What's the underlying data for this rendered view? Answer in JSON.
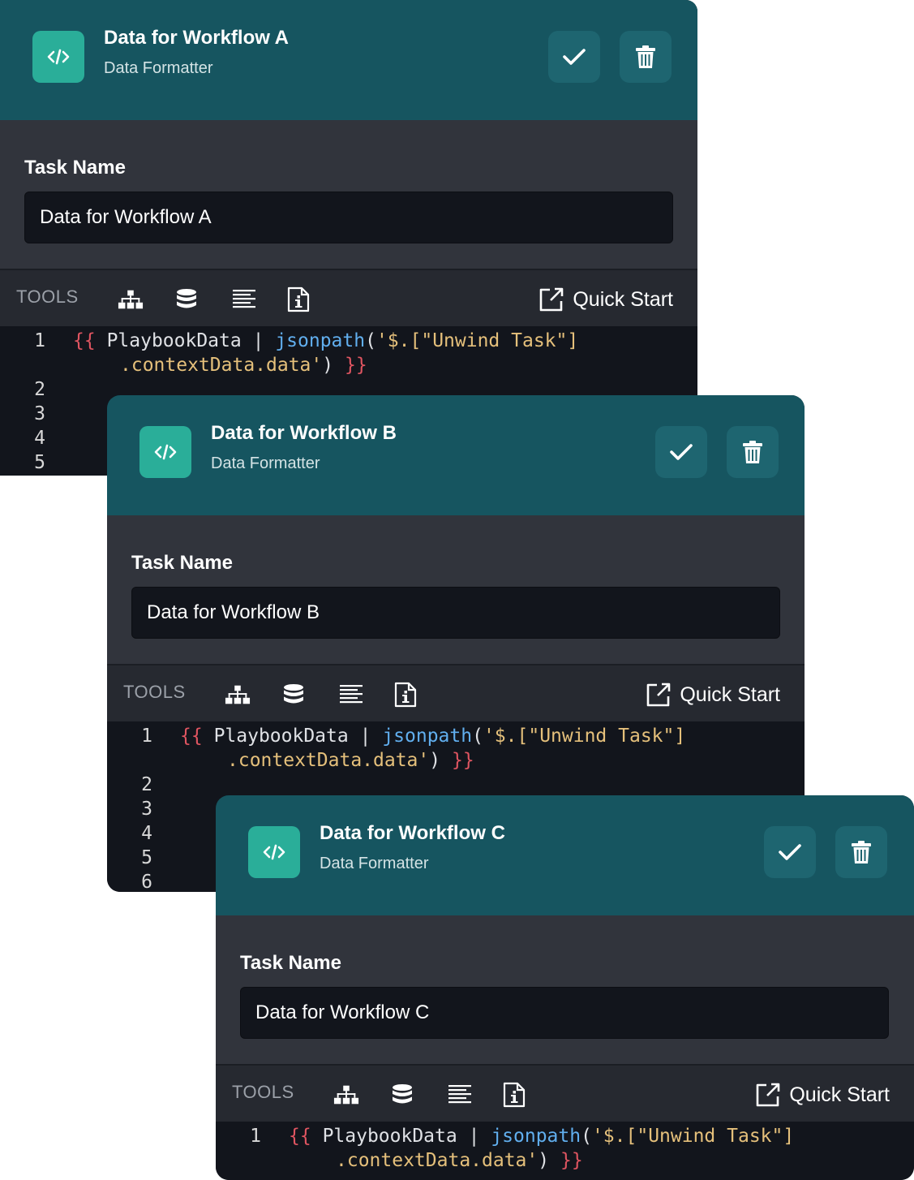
{
  "cards": [
    {
      "title": "Data for Workflow A",
      "subtitle": "Data Formatter",
      "task_label": "Task Name",
      "task_value": "Data for Workflow A",
      "tools_label": "TOOLS",
      "quick_start": "Quick Start",
      "line_numbers": [
        "1",
        "2",
        "3",
        "4",
        "5"
      ]
    },
    {
      "title": "Data for Workflow B",
      "subtitle": "Data Formatter",
      "task_label": "Task Name",
      "task_value": "Data for Workflow B",
      "tools_label": "TOOLS",
      "quick_start": "Quick Start",
      "line_numbers": [
        "1",
        "2",
        "3",
        "4",
        "5",
        "6"
      ]
    },
    {
      "title": "Data for Workflow C",
      "subtitle": "Data Formatter",
      "task_label": "Task Name",
      "task_value": "Data for Workflow C",
      "tools_label": "TOOLS",
      "quick_start": "Quick Start",
      "line_numbers": [
        "1"
      ]
    }
  ],
  "code": {
    "open": "{{",
    "var": "PlaybookData",
    "pipe": "|",
    "fn": "jsonpath",
    "paren_open": "(",
    "str1": "'$.[\"Unwind Task\"]",
    "str2": ".contextData.data'",
    "paren_close": ")",
    "close": "}}"
  },
  "icons": {
    "header": "code-icon",
    "confirm": "check-icon",
    "delete": "trash-icon",
    "tools": [
      "sitemap-icon",
      "database-icon",
      "align-left-icon",
      "info-file-icon"
    ],
    "quick_start": "external-link-icon"
  },
  "colors": {
    "header_bg": "#165560",
    "accent": "#2aae99",
    "panel_bg": "#31343c",
    "tools_bg": "#262930",
    "editor_bg": "#12151c",
    "code_brace": "#e05561",
    "code_function": "#61afef",
    "code_string": "#e5c07b"
  }
}
